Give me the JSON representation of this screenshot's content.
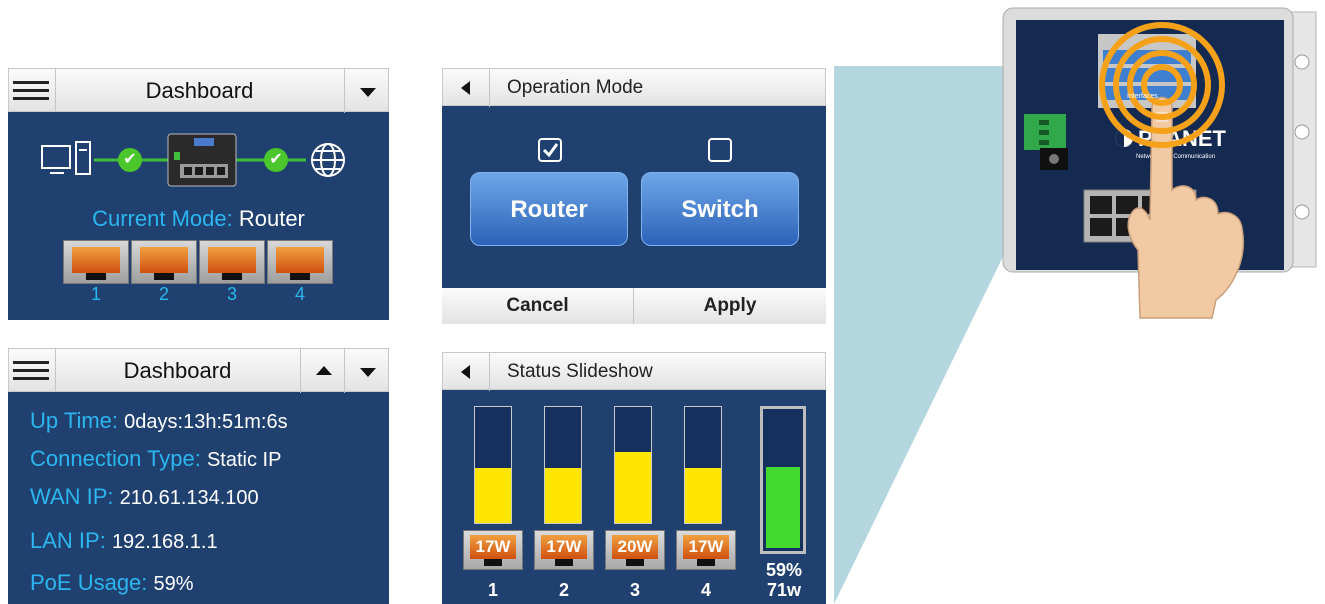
{
  "dashboard_mode": {
    "title": "Dashboard",
    "mode_label": "Current Mode:",
    "mode_value": "Router",
    "ports": [
      "1",
      "2",
      "3",
      "4"
    ],
    "check_glyph": "✔"
  },
  "operation_mode": {
    "title": "Operation Mode",
    "router_label": "Router",
    "switch_label": "Switch",
    "router_checked": true,
    "switch_checked": false,
    "cancel_label": "Cancel",
    "apply_label": "Apply"
  },
  "dashboard_info": {
    "title": "Dashboard",
    "rows": [
      {
        "label": "Up Time:",
        "value": "0days:13h:51m:6s"
      },
      {
        "label": "Connection Type:",
        "value": "Static IP"
      },
      {
        "label": "WAN IP:",
        "value": "210.61.134.100"
      },
      {
        "label": "LAN IP:",
        "value": "192.168.1.1"
      },
      {
        "label": "PoE Usage:",
        "value": "59%"
      }
    ]
  },
  "status_slideshow": {
    "title": "Status Slideshow",
    "ports": [
      {
        "num": "1",
        "watts": "17W",
        "fill": 0.47
      },
      {
        "num": "2",
        "watts": "17W",
        "fill": 0.47
      },
      {
        "num": "3",
        "watts": "20W",
        "fill": 0.61
      },
      {
        "num": "4",
        "watts": "17W",
        "fill": 0.47
      }
    ],
    "total_fill": 0.59,
    "total_percent": "59%",
    "total_watts": "71w"
  },
  "device": {
    "menu_items": [
      "",
      "",
      "Interfaces"
    ],
    "brand": "PLANET",
    "tagline": "Networking & Communication"
  },
  "colors": {
    "panel_navy": "#20406f",
    "accent_cyan": "#2bb6f0",
    "bar_yellow": "#ffe600",
    "bar_green": "#43d92e",
    "port_orange": "#e07020",
    "ring_orange": "#f5a21a",
    "callout_teal": "#a7cfd9"
  }
}
